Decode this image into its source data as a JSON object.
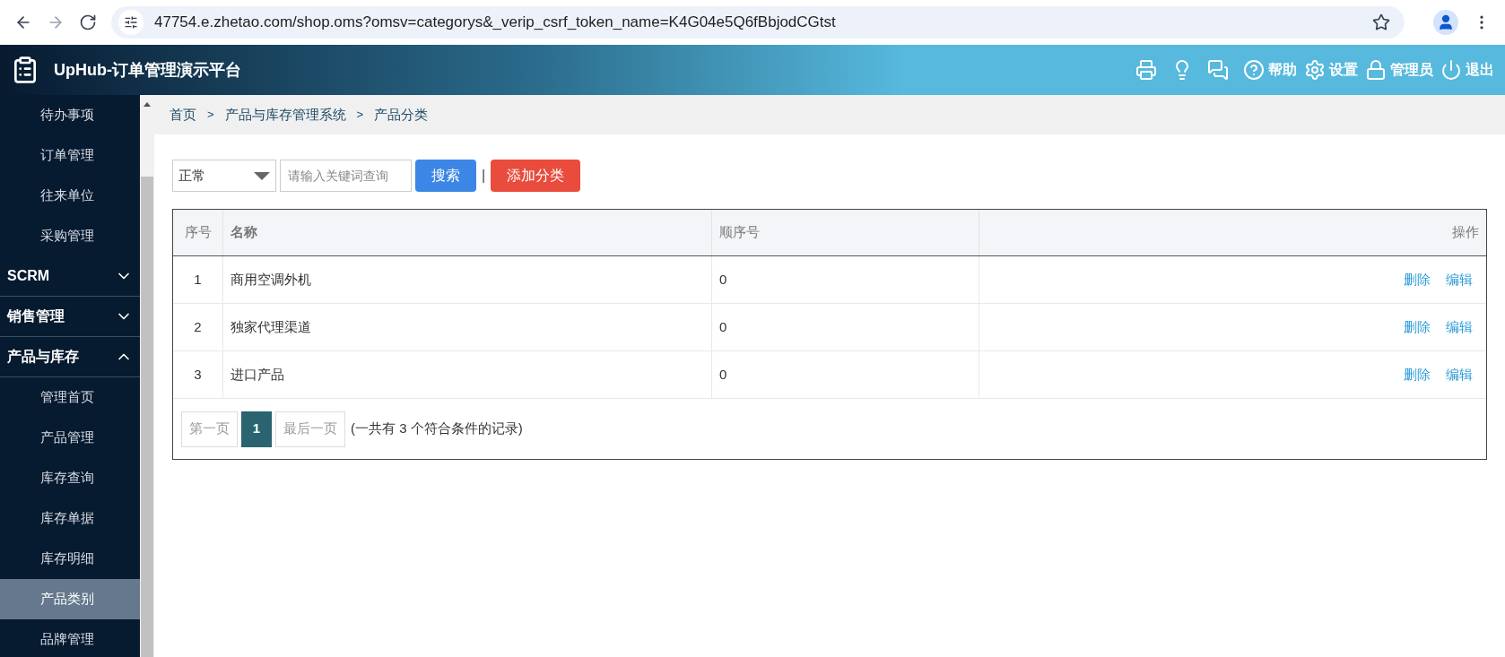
{
  "browser": {
    "url": "47754.e.zhetao.com/shop.oms?omsv=categorys&_verip_csrf_token_name=K4G04e5Q6fBbjodCGtst"
  },
  "header": {
    "title": "UpHub-订单管理演示平台",
    "actions": [
      {
        "kind": "print"
      },
      {
        "kind": "bulb"
      },
      {
        "kind": "chat"
      },
      {
        "kind": "help",
        "label": "帮助"
      },
      {
        "kind": "settings",
        "label": "设置"
      },
      {
        "kind": "lock",
        "label": "管理员"
      },
      {
        "kind": "power",
        "label": "退出"
      }
    ]
  },
  "sidebar": {
    "items": [
      {
        "kind": "item",
        "label": "待办事项",
        "selected": false
      },
      {
        "kind": "item",
        "label": "订单管理",
        "selected": false
      },
      {
        "kind": "item",
        "label": "往来单位",
        "selected": false
      },
      {
        "kind": "item",
        "label": "采购管理",
        "selected": false
      },
      {
        "kind": "group",
        "label": "SCRM",
        "expanded": false
      },
      {
        "kind": "group",
        "label": "销售管理",
        "expanded": false
      },
      {
        "kind": "group",
        "label": "产品与库存",
        "expanded": true
      },
      {
        "kind": "item",
        "label": "管理首页",
        "selected": false
      },
      {
        "kind": "item",
        "label": "产品管理",
        "selected": false
      },
      {
        "kind": "item",
        "label": "库存查询",
        "selected": false
      },
      {
        "kind": "item",
        "label": "库存单据",
        "selected": false
      },
      {
        "kind": "item",
        "label": "库存明细",
        "selected": false
      },
      {
        "kind": "item",
        "label": "产品类别",
        "selected": true
      },
      {
        "kind": "item",
        "label": "品牌管理",
        "selected": false
      }
    ]
  },
  "breadcrumb": [
    {
      "label": "首页"
    },
    {
      "separator": ">",
      "label": "产品与库存管理系统"
    },
    {
      "separator": ">",
      "label": "产品分类"
    }
  ],
  "filter": {
    "status": "正常",
    "placeholder": "请输入关键词查询",
    "search_button": "搜索",
    "divider": "|",
    "add_button": "添加分类"
  },
  "table": {
    "columns": [
      "序号",
      "名称",
      "顺序号",
      "操作"
    ],
    "rows": [
      {
        "index": "1",
        "name": "商用空调外机",
        "order": "0",
        "actions": [
          "删除",
          "编辑"
        ]
      },
      {
        "index": "2",
        "name": "独家代理渠道",
        "order": "0",
        "actions": [
          "删除",
          "编辑"
        ]
      },
      {
        "index": "3",
        "name": "进口产品",
        "order": "0",
        "actions": [
          "删除",
          "编辑"
        ]
      }
    ]
  },
  "pagination": {
    "first": "第一页",
    "pages": [
      {
        "label": "1",
        "selected": true
      }
    ],
    "last": "最后一页",
    "summary": "(一共有 3 个符合条件的记录)"
  }
}
